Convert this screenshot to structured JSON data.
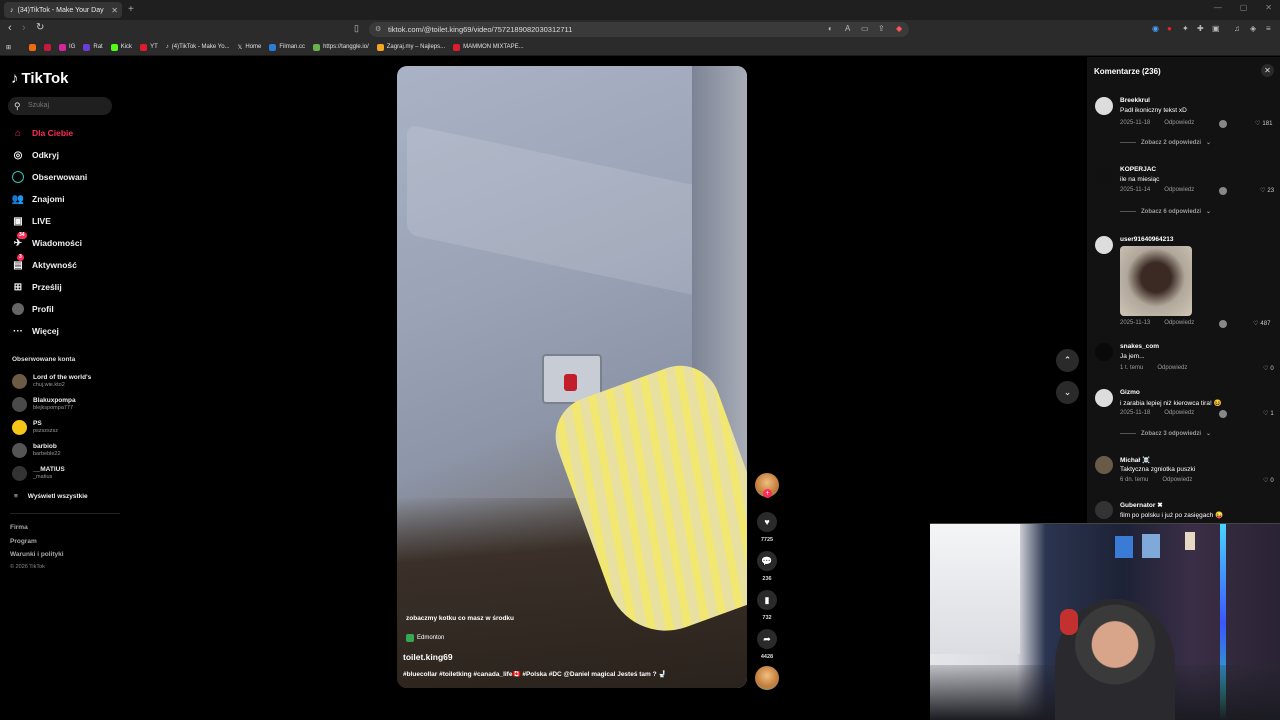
{
  "browser": {
    "tab_title": "(34)TikTok - Make Your Day",
    "url": "tiktok.com/@toilet.king69/video/7572189082030312711",
    "bookmarks": [
      "IG",
      "Rat",
      "Kick",
      "YT",
      "(4)TikTok - Make Yo...",
      "Home",
      "Filman.cc",
      "https://tanggle.io/",
      "Zagraj.my – Najleps...",
      "MAMMON MIXTAPE..."
    ]
  },
  "sidebar": {
    "logo": "TikTok",
    "search_placeholder": "Szukaj",
    "nav": [
      {
        "label": "Dla Ciebie",
        "icon": "home-icon"
      },
      {
        "label": "Odkryj",
        "icon": "compass-icon"
      },
      {
        "label": "Obserwowani",
        "icon": "following-icon"
      },
      {
        "label": "Znajomi",
        "icon": "friends-icon"
      },
      {
        "label": "LIVE",
        "icon": "live-icon"
      },
      {
        "label": "Wiadomości",
        "icon": "messages-icon",
        "badge": "34"
      },
      {
        "label": "Aktywność",
        "icon": "activity-icon",
        "badge": "3"
      },
      {
        "label": "Prześlij",
        "icon": "upload-icon"
      },
      {
        "label": "Profil",
        "icon": "profile-icon"
      },
      {
        "label": "Więcej",
        "icon": "more-icon"
      }
    ],
    "followed_title": "Obserwowane konta",
    "accounts": [
      {
        "name": "Lord of the world's",
        "handle": "chuj.wie.kto2"
      },
      {
        "name": "Blakuxpompa",
        "handle": "blejkspompa777"
      },
      {
        "name": "PS",
        "handle": "pszszszsz"
      },
      {
        "name": "barbiob",
        "handle": "barbeble22"
      },
      {
        "name": "__MATIUS",
        "handle": "_matius"
      }
    ],
    "show_all": "Wyświetl wszystkie",
    "footer": [
      "Firma",
      "Program",
      "Warunki i polityki"
    ],
    "copyright": "© 2026 TikTok"
  },
  "video": {
    "caption_top": "zobaczmy kotku co masz w środku",
    "location": "Edmonton",
    "author": "toilet.king69",
    "tags": "#bluecollar #toiletking #canada_life🇨🇦 #Polska #DC @Daniel magical Jesteś tam ? 🚽"
  },
  "actions": {
    "likes": "7725",
    "comments": "236",
    "saves": "732",
    "shares": "4428"
  },
  "comments": {
    "title": "Komentarze (236)",
    "reply_label": "Odpowiedz",
    "items": [
      {
        "user": "Breekkrul",
        "text": "Padł ikoniczny tekst xD",
        "date": "2025-11-18",
        "likes": "181",
        "replies": "Zobacz 2 odpowiedzi"
      },
      {
        "user": "KOPERJAC",
        "text": "ile na miesiąc",
        "date": "2025-11-14",
        "likes": "23",
        "replies": "Zobacz 6 odpowiedzi"
      },
      {
        "user": "user91640964213",
        "text": "",
        "date": "2025-11-13",
        "likes": "487"
      },
      {
        "user": "snakes_com",
        "text": "Ja jem...",
        "date": "1 t. temu",
        "likes": "0"
      },
      {
        "user": "Gizmo",
        "text": "i zarabia lepiej niż kierowca tira! 😆",
        "date": "2025-11-18",
        "likes": "1",
        "replies": "Zobacz 3 odpowiedzi"
      },
      {
        "user": "Michał ☠️",
        "text": "Taktyczna zgniotka puszki",
        "date": "6 dn. temu",
        "likes": "0"
      },
      {
        "user": "Gubernator ✖",
        "text": "film po polsku i już po zasięgach 😜"
      }
    ]
  }
}
